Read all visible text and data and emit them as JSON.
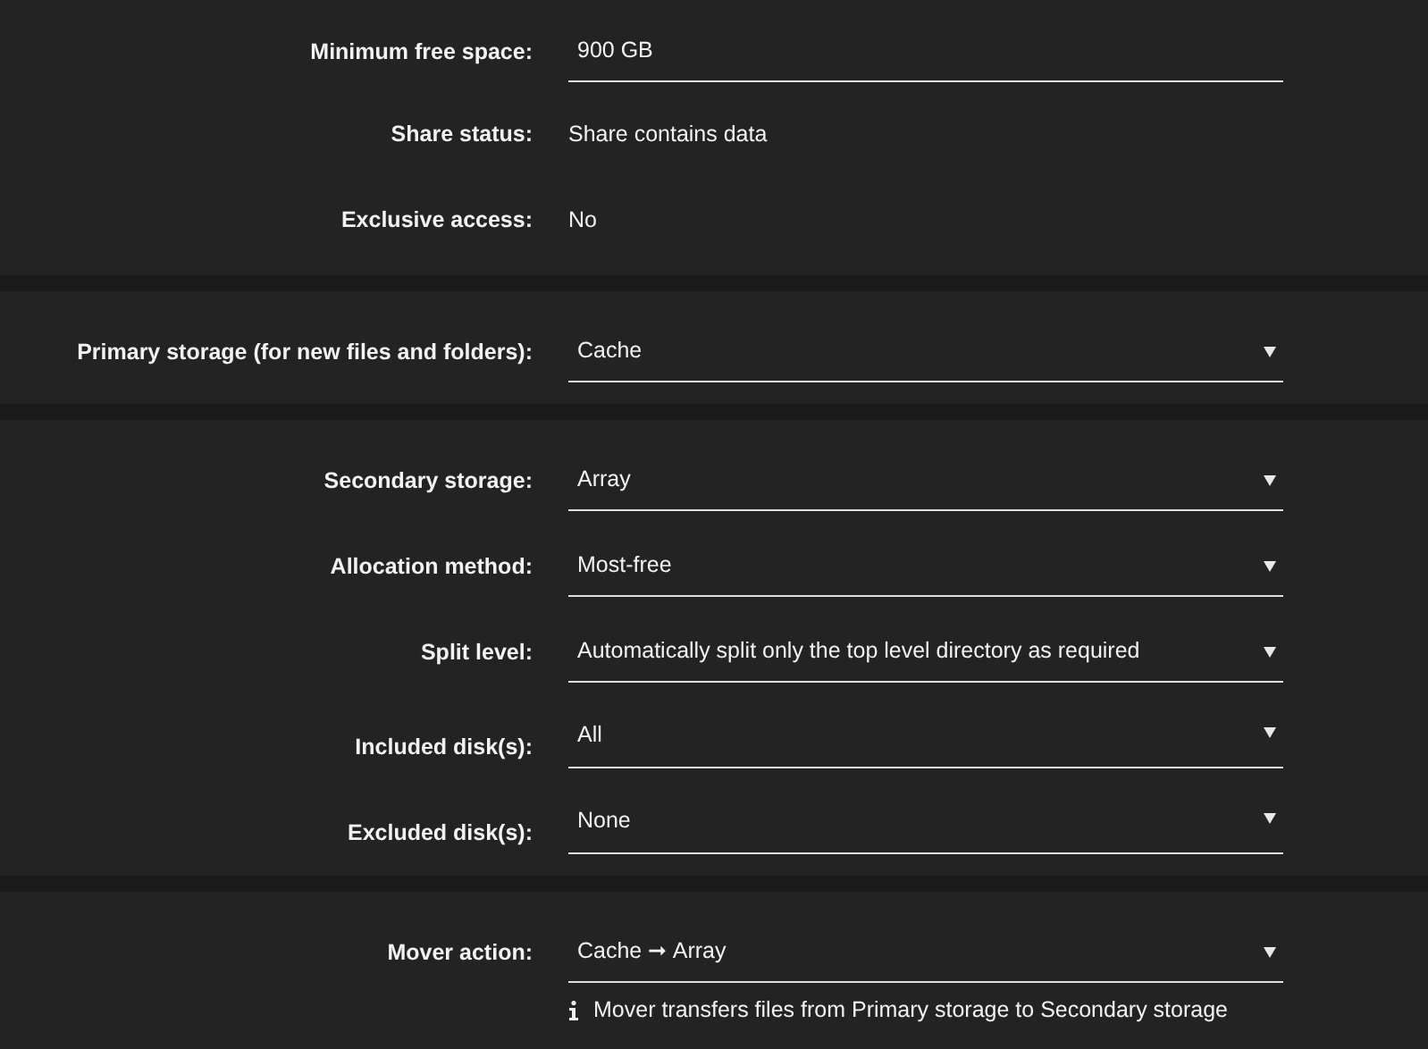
{
  "sections": [
    {
      "rows": [
        {
          "label": "Minimum free space:",
          "kind": "input",
          "value": "900 GB"
        },
        {
          "label": "Share status:",
          "kind": "text",
          "value": "Share contains data"
        },
        {
          "label": "Exclusive access:",
          "kind": "text",
          "value": "No"
        }
      ]
    },
    {
      "rows": [
        {
          "label": "Primary storage (for new files and folders):",
          "kind": "select",
          "value": "Cache"
        }
      ]
    },
    {
      "rows": [
        {
          "label": "Secondary storage:",
          "kind": "select",
          "value": "Array"
        },
        {
          "label": "Allocation method:",
          "kind": "select",
          "value": "Most-free"
        },
        {
          "label": "Split level:",
          "kind": "select",
          "value": "Automatically split only the top level directory as required"
        },
        {
          "label": "Included disk(s):",
          "kind": "multiselect",
          "value": "All"
        },
        {
          "label": "Excluded disk(s):",
          "kind": "multiselect",
          "value": "None"
        }
      ]
    },
    {
      "rows": [
        {
          "label": "Mover action:",
          "kind": "select",
          "value": "Cache ➞ Array",
          "note": "Mover transfers files from Primary storage to Secondary storage"
        }
      ]
    }
  ]
}
